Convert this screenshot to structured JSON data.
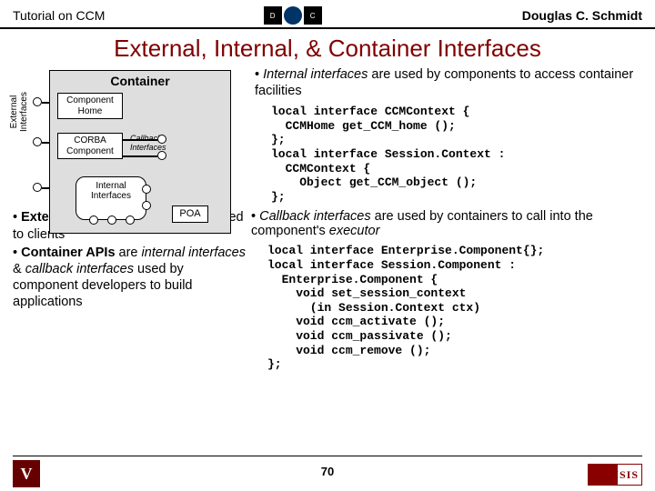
{
  "header": {
    "left": "Tutorial on CCM",
    "right": "Douglas C. Schmidt"
  },
  "title": "External, Internal, & Container Interfaces",
  "diagram": {
    "ext_label": "External\nInterfaces",
    "container": "Container",
    "comp_home": "Component\nHome",
    "corba_comp": "CORBA\nComponent",
    "callback": "Callback\nInterfaces",
    "internal": "Internal\nInterfaces",
    "poa": "POA"
  },
  "bullets": {
    "internal_pre": "Internal interfaces",
    "internal_post": " are used by components to access container facilities",
    "code1": "local interface CCMContext {\n  CCMHome get_CCM_home ();\n};\nlocal interface Session.Context :\n  CCMContext {\n    Object get_CCM_object ();\n};",
    "callback_pre": "Callback interfaces",
    "callback_post": " are used by containers to call into the component's ",
    "callback_exec": "executor",
    "code2": "local interface Enterprise.Component{};\nlocal interface Session.Component :\n  Enterprise.Component {\n    void set_session_context\n      (in Session.Context ctx)\n    void ccm_activate ();\n    void ccm_passivate ();\n    void ccm_remove ();\n};",
    "ext_api_b": "External APIs",
    "ext_api_t": " are interfaces provided to clients",
    "cont_api_b": "Container APIs",
    "cont_api_t1": " are ",
    "cont_api_i1": "internal interfaces",
    "cont_api_t2": " & ",
    "cont_api_i2": "callback interfaces",
    "cont_api_t3": " used by component developers to build applications"
  },
  "page": "70"
}
